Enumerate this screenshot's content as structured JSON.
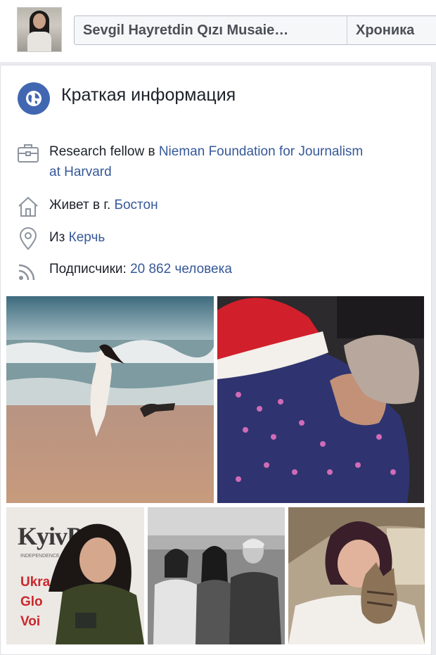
{
  "header": {
    "profile_name": "Sevgil Hayretdin Qızı Musaie…",
    "timeline_label": "Хроника"
  },
  "intro": {
    "title": "Краткая информация",
    "work": {
      "prefix": "Research fellow в ",
      "link": "Nieman Foundation for Journalism at Harvard"
    },
    "lives": {
      "prefix": "Живет в г. ",
      "link": "Бостон"
    },
    "from": {
      "prefix": "Из ",
      "link": "Керчь"
    },
    "followers": {
      "prefix": "Подписчики: ",
      "link": "20 862 человека"
    }
  },
  "photos": {
    "kyiv_post_sign": "KyivPost",
    "kyiv_post_tagline": "INDEPENDENCE. COMMUNITY.",
    "kyiv_post_poster": [
      "Ukra",
      "Glo",
      "Voi"
    ]
  },
  "colors": {
    "link": "#365899",
    "accent": "#4267b2"
  }
}
